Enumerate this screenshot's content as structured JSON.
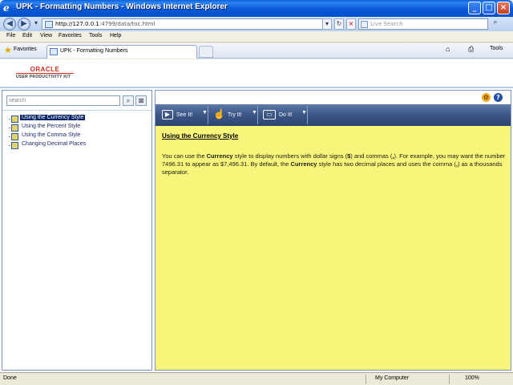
{
  "window": {
    "title": "UPK - Formatting Numbers - Windows Internet Explorer",
    "min_label": "_",
    "max_label": "□",
    "close_label": "×"
  },
  "address": {
    "url_host": "http://127.0.0.1",
    "url_rest": ":4799/data/toc.html",
    "back_icon": "◀",
    "forward_icon": "▶",
    "refresh_icon": "↻",
    "stop_icon": "×",
    "dropdown_icon": "▾"
  },
  "livesearch": {
    "placeholder": "Live Search",
    "go_icon": "⌕"
  },
  "menu": [
    "File",
    "Edit",
    "View",
    "Favorites",
    "Tools",
    "Help"
  ],
  "favorites": {
    "label": "Favorites"
  },
  "tab": {
    "label": "UPK - Formatting Numbers"
  },
  "toolbar_right": {
    "home": "⌂",
    "print": "⎙",
    "tools": "Tools",
    "more": "»"
  },
  "logo": {
    "oracle": "ORACLE",
    "upk": "USER PRODUCTIVITY KIT"
  },
  "left": {
    "search_placeholder": "search",
    "search_icon": "⌕",
    "clear_icon": "⊠",
    "tree": [
      {
        "label": "Using the Currency Style",
        "selected": true
      },
      {
        "label": "Using the Percent Style",
        "selected": false
      },
      {
        "label": "Using the Comma Style",
        "selected": false
      },
      {
        "label": "Changing Decimal Places",
        "selected": false
      }
    ]
  },
  "right": {
    "modes": [
      {
        "label": "See It!",
        "icon": "▶"
      },
      {
        "label": "Try It!",
        "icon": "☝"
      },
      {
        "label": "Do It!",
        "icon": "▭"
      }
    ],
    "title": "Using the Currency Style",
    "body_parts": [
      {
        "t": "You can use the ",
        "b": false
      },
      {
        "t": "Currency",
        "b": true
      },
      {
        "t": " style to display numbers with dollar signs (",
        "b": false
      },
      {
        "t": "$",
        "b": true
      },
      {
        "t": ") and commas (",
        "b": false
      },
      {
        "t": ",",
        "b": true
      },
      {
        "t": "). For example, you may want the number 7496.31 to appear as $7,496.31. By default, the ",
        "b": false
      },
      {
        "t": "Currency",
        "b": true
      },
      {
        "t": " style has two decimal places and uses the comma (",
        "b": false
      },
      {
        "t": ",",
        "b": true
      },
      {
        "t": ") as a thousands separator.",
        "b": false
      }
    ]
  },
  "status": {
    "left": "Done",
    "zone": "My Computer",
    "zoom": "100%"
  }
}
